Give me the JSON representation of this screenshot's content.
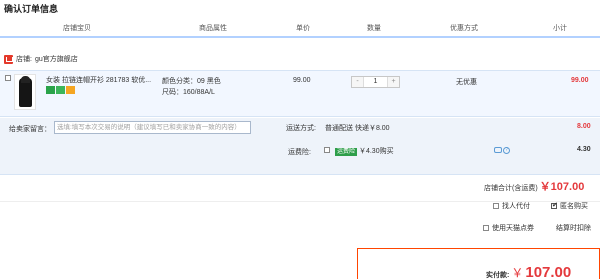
{
  "page_title": "确认订单信息",
  "columns": {
    "item": "店铺宝贝",
    "attrs": "商品属性",
    "price": "单价",
    "qty": "数量",
    "promo": "优惠方式",
    "subtotal": "小计"
  },
  "shop": {
    "prefix": "店铺:",
    "name": "gu官方旗舰店"
  },
  "item": {
    "title": "女装 拉链连帽开衫 281783 软优...",
    "attr_color": "颜色分类：09 黑色",
    "attr_size": "尺码：160/88A/L",
    "price": "99.00",
    "qty_minus": "-",
    "qty": "1",
    "qty_plus": "+",
    "promo": "无优惠",
    "subtotal": "99.00"
  },
  "message": {
    "label": "给卖家留言：",
    "placeholder": "选填:填写本次交易的说明（建议填写已和卖家协商一致的内容）"
  },
  "shipping": {
    "label": "运送方式:",
    "method": "普通配送 快递￥8.00",
    "amount": "8.00"
  },
  "insurance": {
    "label": "运费险:",
    "tag": "运费险",
    "desc": "￥4.30购买",
    "amount": "4.30"
  },
  "shop_total": {
    "label": "店铺合计(含运费)",
    "value": "￥107.00"
  },
  "options": {
    "proxy_pay": "找人代付",
    "anonymous": "匿名购买",
    "tmall_points": "使用天猫点券",
    "deduct_on_checkout": "结算时扣除"
  },
  "pay": {
    "label": "实付款:",
    "currency": "￥",
    "amount": "107.00"
  },
  "colors": {
    "accent_red": "#e4393c",
    "header_border": "#b2d1ff",
    "row_bg": "#f2f7ff"
  }
}
